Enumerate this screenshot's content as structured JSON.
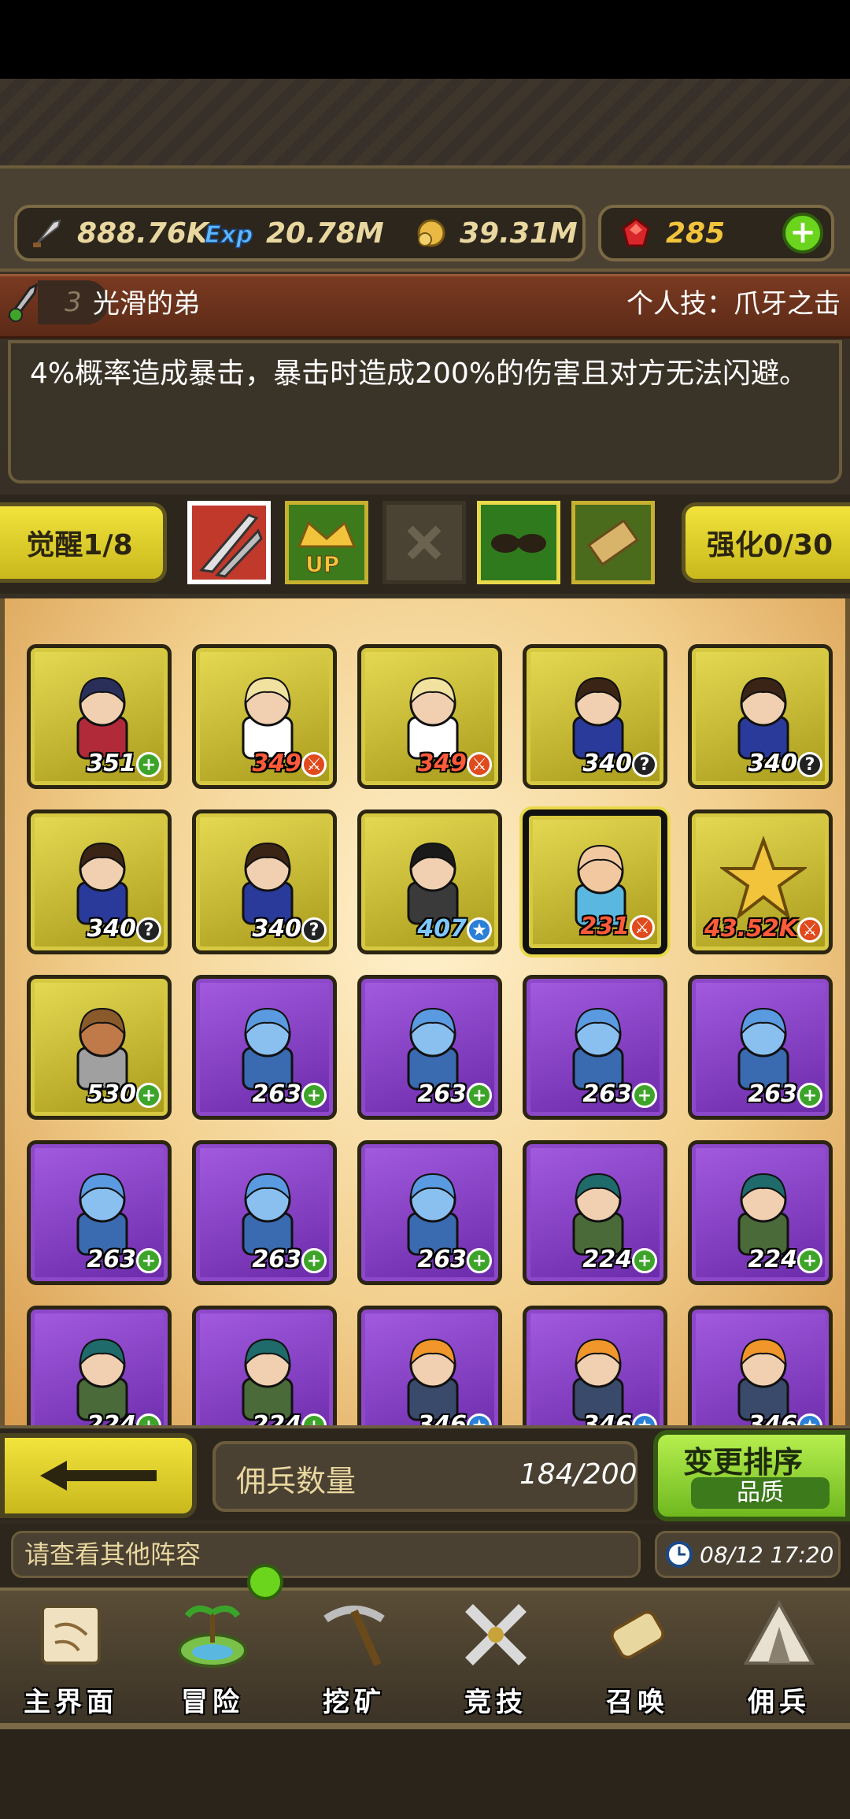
{
  "resources": {
    "attack": "888.76K",
    "exp": "20.78M",
    "gold": "39.31M",
    "gems": "285"
  },
  "skill": {
    "level": "3",
    "name": "光滑的弟",
    "type": "个人技：爪牙之击",
    "description": "4%概率造成暴击，暴击时造成200%的伤害且对方无法闪避。"
  },
  "equip": {
    "awaken_label": "觉醒1/8",
    "enhance_label": "强化0/30"
  },
  "heroes": [
    {
      "frame": "gold",
      "level": "351",
      "badge": "plus",
      "color": "white",
      "sprite": "dark-caped"
    },
    {
      "frame": "gold",
      "level": "349",
      "badge": "sword",
      "color": "red",
      "sprite": "blonde"
    },
    {
      "frame": "gold",
      "level": "349",
      "badge": "sword",
      "color": "red",
      "sprite": "blonde"
    },
    {
      "frame": "gold",
      "level": "340",
      "badge": "q",
      "color": "white",
      "sprite": "brown-hair"
    },
    {
      "frame": "gold",
      "level": "340",
      "badge": "q",
      "color": "white",
      "sprite": "brown-hair"
    },
    {
      "frame": "gold",
      "level": "340",
      "badge": "q",
      "color": "white",
      "sprite": "brown-hair"
    },
    {
      "frame": "gold",
      "level": "340",
      "badge": "q",
      "color": "white",
      "sprite": "brown-hair"
    },
    {
      "frame": "gold",
      "level": "407",
      "badge": "star",
      "color": "blue",
      "sprite": "dark-girl"
    },
    {
      "frame": "gold",
      "level": "231",
      "badge": "sword",
      "color": "red",
      "sprite": "bald-goggles",
      "selected": true
    },
    {
      "frame": "gold",
      "level": "43.52K",
      "badge": "sword",
      "color": "red",
      "sprite": "star"
    },
    {
      "frame": "gold",
      "level": "530",
      "badge": "plus",
      "color": "white",
      "sprite": "deer"
    },
    {
      "frame": "purple",
      "level": "263",
      "badge": "plus",
      "color": "white",
      "sprite": "gargoyle"
    },
    {
      "frame": "purple",
      "level": "263",
      "badge": "plus",
      "color": "white",
      "sprite": "gargoyle"
    },
    {
      "frame": "purple",
      "level": "263",
      "badge": "plus",
      "color": "white",
      "sprite": "gargoyle"
    },
    {
      "frame": "purple",
      "level": "263",
      "badge": "plus",
      "color": "white",
      "sprite": "gargoyle"
    },
    {
      "frame": "purple",
      "level": "263",
      "badge": "plus",
      "color": "white",
      "sprite": "gargoyle"
    },
    {
      "frame": "purple",
      "level": "263",
      "badge": "plus",
      "color": "white",
      "sprite": "gargoyle"
    },
    {
      "frame": "purple",
      "level": "263",
      "badge": "plus",
      "color": "white",
      "sprite": "gargoyle"
    },
    {
      "frame": "purple",
      "level": "224",
      "badge": "plus",
      "color": "white",
      "sprite": "teal-hair"
    },
    {
      "frame": "purple",
      "level": "224",
      "badge": "plus",
      "color": "white",
      "sprite": "teal-hair"
    },
    {
      "frame": "purple",
      "level": "224",
      "badge": "plus",
      "color": "white",
      "sprite": "teal-hair"
    },
    {
      "frame": "purple",
      "level": "224",
      "badge": "plus",
      "color": "white",
      "sprite": "teal-hair"
    },
    {
      "frame": "purple",
      "level": "346",
      "badge": "star",
      "color": "white",
      "sprite": "orange-hair"
    },
    {
      "frame": "purple",
      "level": "346",
      "badge": "star",
      "color": "white",
      "sprite": "orange-hair"
    },
    {
      "frame": "purple",
      "level": "346",
      "badge": "star",
      "color": "white",
      "sprite": "orange-hair"
    }
  ],
  "footer": {
    "count_label": "佣兵数量",
    "count_value": "184/200",
    "sort_title": "变更排序",
    "sort_mode": "品质",
    "notice": "请查看其他阵容",
    "time": "08/12 17:20"
  },
  "nav": [
    {
      "label": "主界面",
      "icon": "scroll-map-icon"
    },
    {
      "label": "冒险",
      "icon": "island-icon"
    },
    {
      "label": "挖矿",
      "icon": "pickaxe-icon"
    },
    {
      "label": "竞技",
      "icon": "crossed-swords-icon"
    },
    {
      "label": "召唤",
      "icon": "summon-scroll-icon"
    },
    {
      "label": "佣兵",
      "icon": "tent-icon"
    }
  ]
}
